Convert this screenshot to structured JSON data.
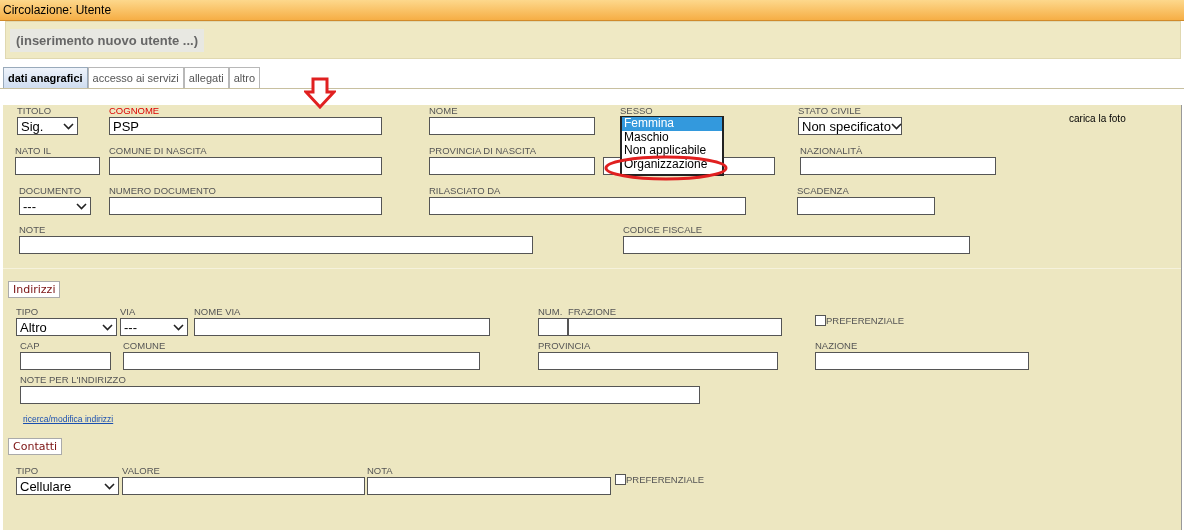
{
  "window": {
    "title": "Circolazione: Utente"
  },
  "header": {
    "label": "(inserimento nuovo utente ...)"
  },
  "tabs": [
    {
      "label": "dati anagrafici",
      "selected": true
    },
    {
      "label": "accesso ai servizi",
      "selected": false
    },
    {
      "label": "allegati",
      "selected": false
    },
    {
      "label": "altro",
      "selected": false
    }
  ],
  "personal": {
    "rows": [
      {
        "fields": [
          {
            "kind": "select",
            "label": "TITOLO",
            "value": "Sig."
          },
          {
            "kind": "text",
            "label": "COGNOME",
            "value": "PSP",
            "required": true
          },
          {
            "kind": "text",
            "label": "NOME"
          },
          {
            "kind": "listbox",
            "label": "SESSO",
            "options": [
              {
                "label": "Femmina",
                "selected": true
              },
              {
                "label": "Maschio",
                "selected": false
              },
              {
                "label": "Non applicabile",
                "selected": false
              },
              {
                "label": "Organizzazione",
                "selected": false
              }
            ]
          },
          {
            "kind": "select",
            "label": "STATO CIVILE",
            "value": "Non specificato"
          },
          {
            "kind": "caption",
            "label": "carica la foto"
          }
        ]
      },
      {
        "fields": [
          {
            "kind": "text",
            "label": "NATO IL"
          },
          {
            "kind": "text",
            "label": "COMUNE DI NASCITA"
          },
          {
            "kind": "text",
            "label": "PROVINCIA DI NASCITA"
          },
          {
            "kind": "text"
          },
          {
            "kind": "text",
            "label": "NAZIONALITÀ"
          }
        ]
      },
      {
        "fields": [
          {
            "kind": "select",
            "label": "DOCUMENTO",
            "value": "---"
          },
          {
            "kind": "text",
            "label": "NUMERO DOCUMENTO"
          },
          {
            "kind": "text",
            "label": "RILASCIATO DA"
          },
          {
            "kind": "text",
            "label": "SCADENZA"
          }
        ]
      },
      {
        "fields": [
          {
            "kind": "text",
            "label": "NOTE"
          },
          {
            "kind": "text",
            "label": "CODICE FISCALE"
          }
        ]
      }
    ]
  },
  "addresses": {
    "legend": "Indirizzi",
    "rows": [
      {
        "fields": [
          {
            "kind": "select",
            "label": "TIPO",
            "value": "Altro"
          },
          {
            "kind": "select",
            "label": "VIA",
            "value": "---"
          },
          {
            "kind": "text",
            "label": "NOME VIA"
          },
          {
            "kind": "text",
            "label": "NUM."
          },
          {
            "kind": "text",
            "label": "FRAZIONE"
          },
          {
            "kind": "checkbox",
            "label": "PREFERENZIALE",
            "checked": false
          }
        ]
      },
      {
        "fields": [
          {
            "kind": "text",
            "label": "CAP"
          },
          {
            "kind": "text",
            "label": "COMUNE"
          },
          {
            "kind": "text",
            "label": "PROVINCIA"
          },
          {
            "kind": "text",
            "label": "NAZIONE"
          }
        ]
      },
      {
        "fields": [
          {
            "kind": "text",
            "label": "NOTE PER L'INDIRIZZO"
          }
        ]
      }
    ],
    "link": "ricerca/modifica indirizzi"
  },
  "contacts": {
    "legend": "Contatti",
    "rows": [
      {
        "fields": [
          {
            "kind": "select",
            "label": "TIPO",
            "value": "Cellulare"
          },
          {
            "kind": "text",
            "label": "VALORE"
          },
          {
            "kind": "text",
            "label": "NOTA"
          },
          {
            "kind": "checkbox",
            "label": "PREFERENZIALE",
            "checked": false
          }
        ]
      }
    ]
  }
}
